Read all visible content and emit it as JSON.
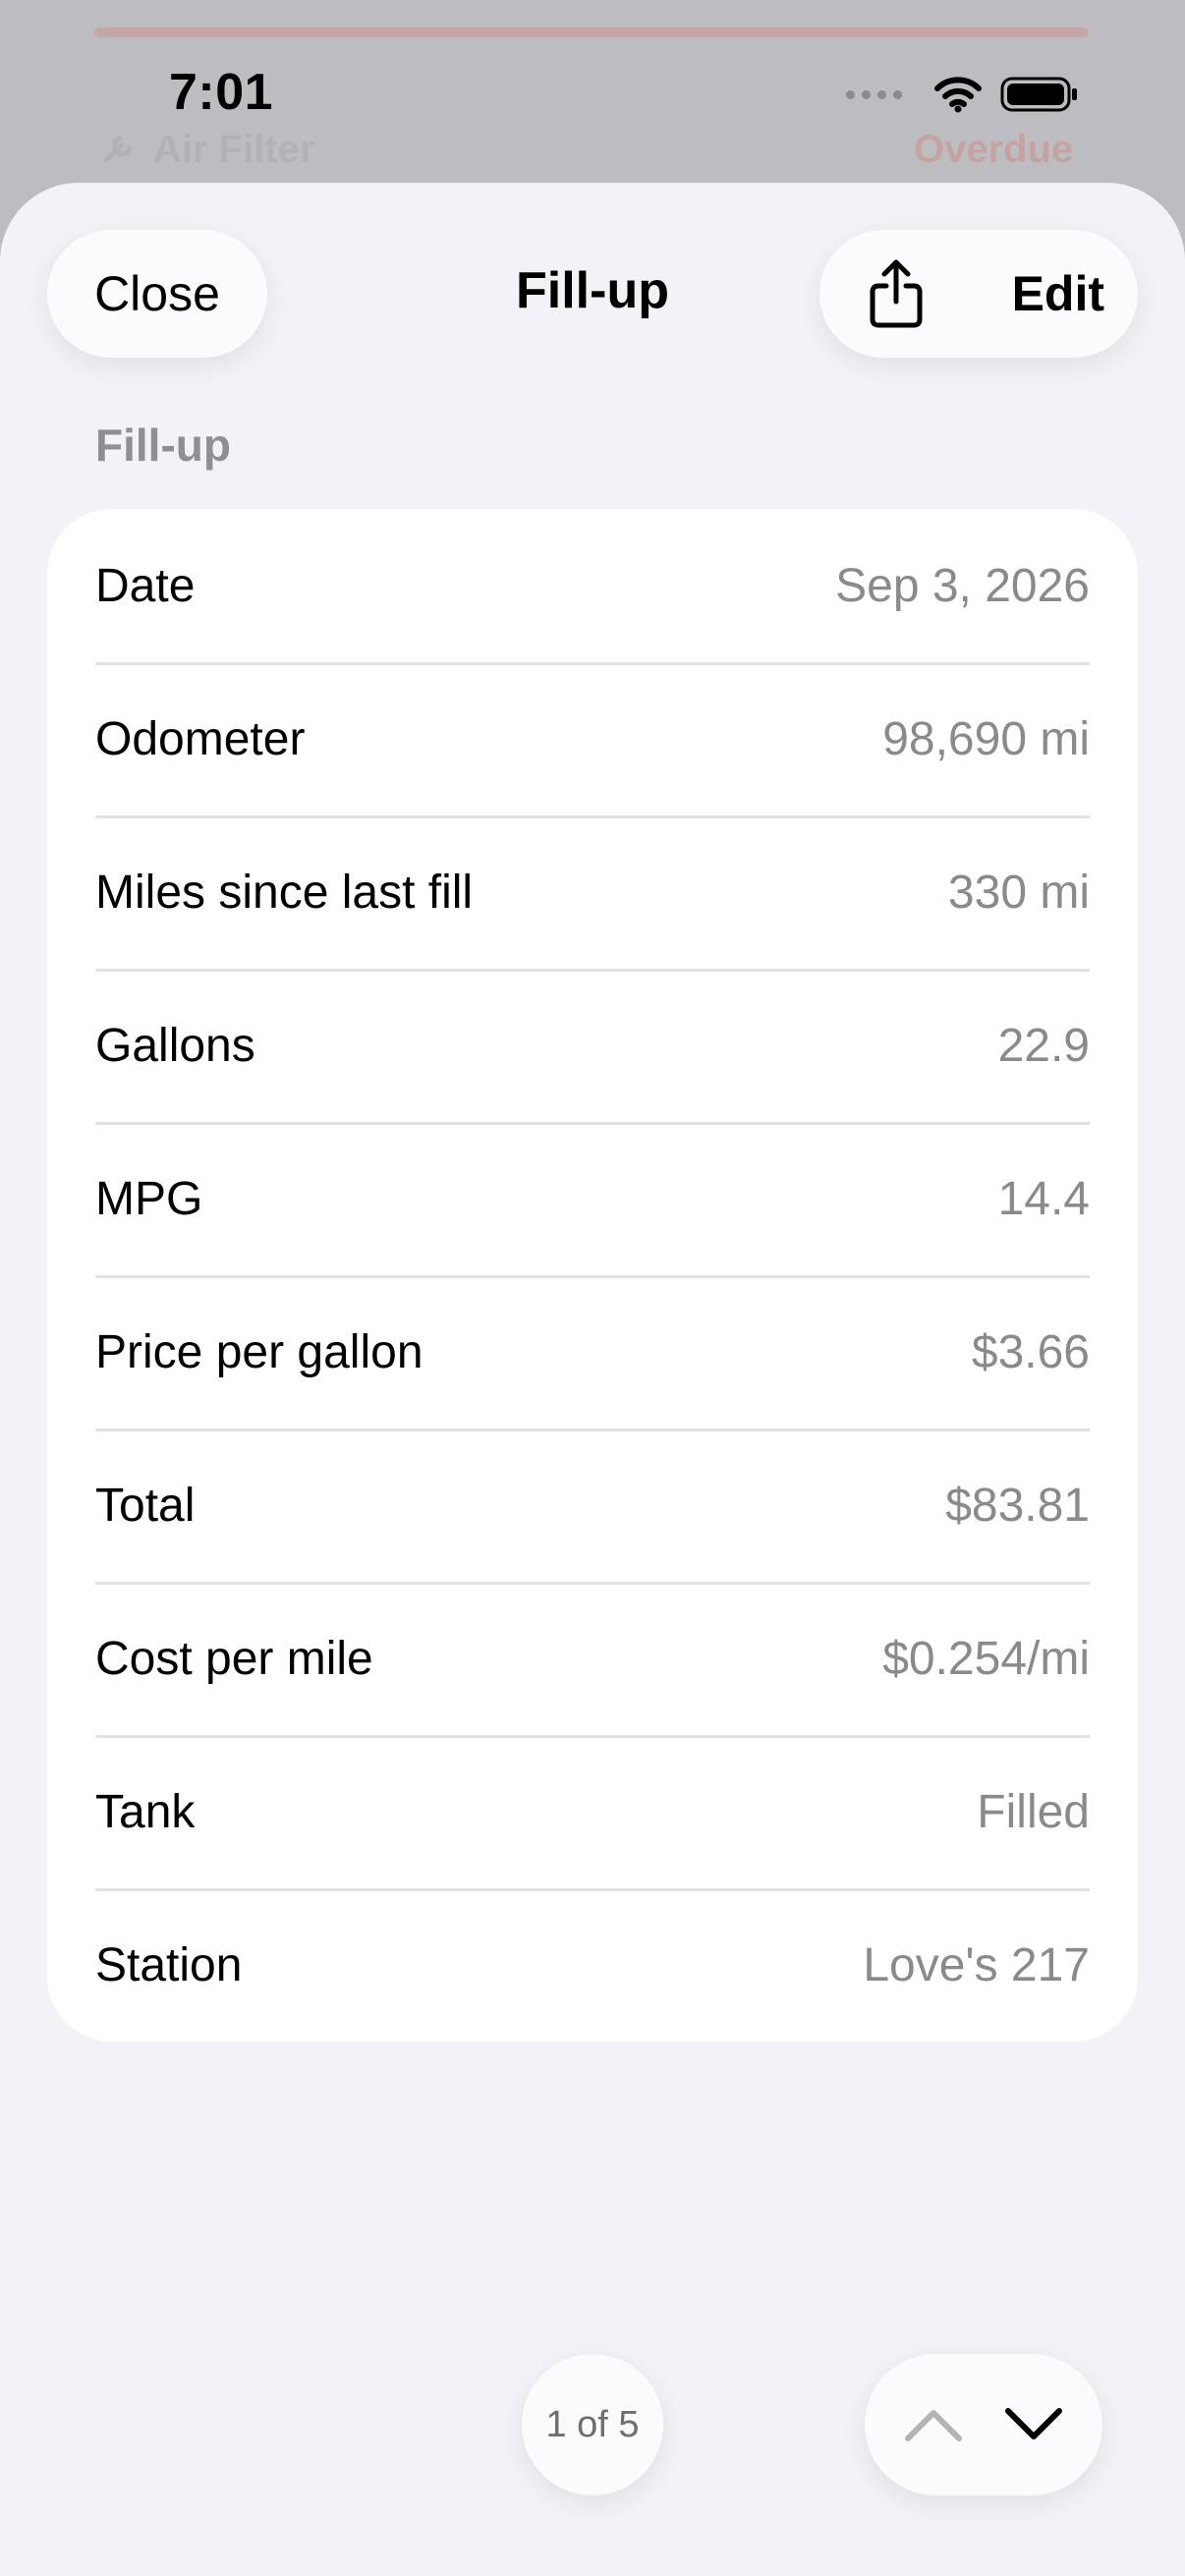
{
  "status_bar": {
    "time": "7:01"
  },
  "background": {
    "row_label": "Air Filter",
    "row_status": "Overdue"
  },
  "sheet": {
    "title": "Fill-up",
    "close_label": "Close",
    "edit_label": "Edit",
    "share_icon": "share-icon",
    "section_header": "Fill-up",
    "rows": [
      {
        "label": "Date",
        "value": "Sep 3, 2026"
      },
      {
        "label": "Odometer",
        "value": "98,690 mi"
      },
      {
        "label": "Miles since last fill",
        "value": "330 mi"
      },
      {
        "label": "Gallons",
        "value": "22.9"
      },
      {
        "label": "MPG",
        "value": "14.4"
      },
      {
        "label": "Price per gallon",
        "value": "$3.66"
      },
      {
        "label": "Total",
        "value": "$83.81"
      },
      {
        "label": "Cost per mile",
        "value": "$0.254/mi"
      },
      {
        "label": "Tank",
        "value": "Filled"
      },
      {
        "label": "Station",
        "value": "Love's 217"
      }
    ],
    "page_indicator": "1 of 5",
    "nav": {
      "up_icon": "chevron-up-icon",
      "down_icon": "chevron-down-icon"
    }
  },
  "colors": {
    "sheet_background": "#f2f2f7",
    "card_background": "#ffffff",
    "secondary_text": "#8a8a8e",
    "dim_overlay": "#bdbdc1"
  }
}
